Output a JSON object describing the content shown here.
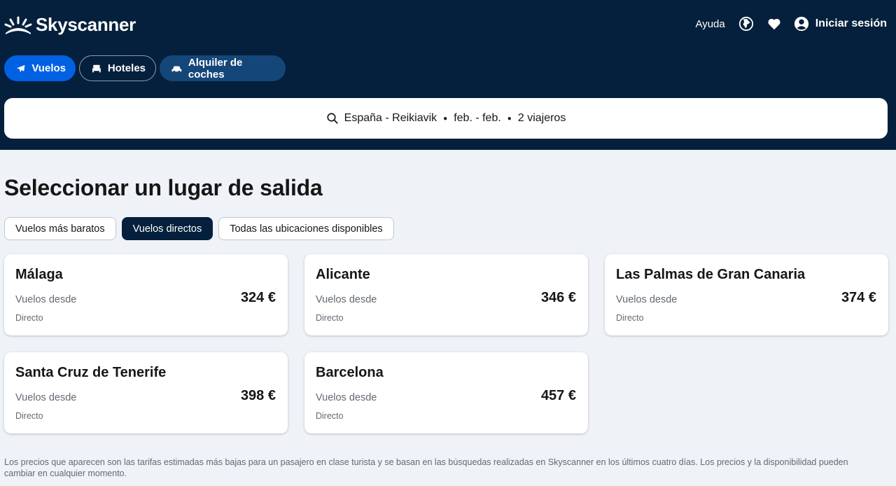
{
  "brand": {
    "name": "Skyscanner"
  },
  "header": {
    "help": "Ayuda",
    "login": "Iniciar sesión"
  },
  "nav": {
    "flights": "Vuelos",
    "hotels": "Hoteles",
    "cars": "Alquiler de coches"
  },
  "search": {
    "route": "España - Reikiavik",
    "dates": "feb. - feb.",
    "travelers": "2 viajeros"
  },
  "page": {
    "title": "Seleccionar un lugar de salida"
  },
  "filters": [
    {
      "label": "Vuelos más baratos",
      "active": false
    },
    {
      "label": "Vuelos directos",
      "active": true
    },
    {
      "label": "Todas las ubicaciones disponibles",
      "active": false
    }
  ],
  "cards": [
    {
      "city": "Málaga",
      "from": "Vuelos desde",
      "price": "324 €",
      "type": "Directo"
    },
    {
      "city": "Alicante",
      "from": "Vuelos desde",
      "price": "346 €",
      "type": "Directo"
    },
    {
      "city": "Las Palmas de Gran Canaria",
      "from": "Vuelos desde",
      "price": "374 €",
      "type": "Directo"
    },
    {
      "city": "Santa Cruz de Tenerife",
      "from": "Vuelos desde",
      "price": "398 €",
      "type": "Directo"
    },
    {
      "city": "Barcelona",
      "from": "Vuelos desde",
      "price": "457 €",
      "type": "Directo"
    }
  ],
  "disclaimer": "Los precios que aparecen son las tarifas estimadas más bajas para un pasajero en clase turista y se basan en las búsquedas realizadas en Skyscanner en los últimos cuatro días. Los precios y la disponibilidad pueden cambiar en cualquier momento.",
  "colors": {
    "header_bg": "#05203c",
    "primary": "#0062e3",
    "secondary_pill": "#154679",
    "page_bg": "#eff3f8"
  },
  "icons": [
    "sunrise-logo-icon",
    "globe-icon",
    "heart-icon",
    "user-icon",
    "plane-icon",
    "bed-icon",
    "car-icon",
    "search-icon"
  ]
}
